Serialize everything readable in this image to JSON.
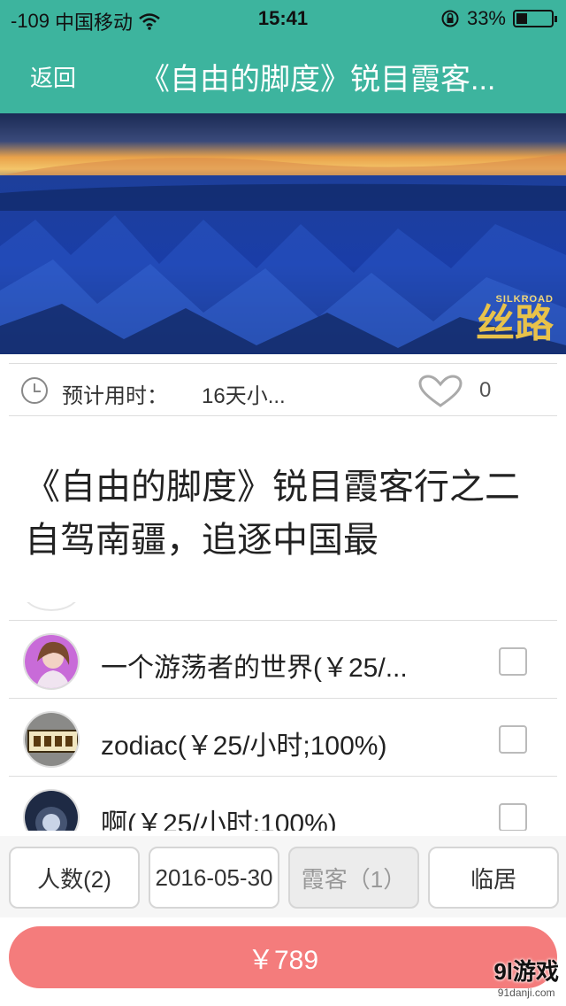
{
  "status_bar": {
    "signal": "-109",
    "carrier": "中国移动",
    "time": "15:41",
    "battery": "33%"
  },
  "nav": {
    "back_label": "返回",
    "title": "《自由的脚度》锐目霞客..."
  },
  "hero": {
    "brand_small": "SILKROAD",
    "brand_big": "丝路"
  },
  "trip": {
    "duration_label": "预计用时：",
    "duration_value": "16天小...",
    "like_count": "0"
  },
  "article": {
    "title": "《自由的脚度》锐目霞客行之二 自驾南疆，追逐中国最"
  },
  "guides": [
    {
      "name": "一个游荡者的世界(￥25/...",
      "checked": false
    },
    {
      "name": "zodiac(￥25/小时;100%)",
      "checked": false
    },
    {
      "name": "啊(￥25/小时;100%)",
      "checked": false
    }
  ],
  "options": {
    "people": "人数(2)",
    "date": "2016-05-30",
    "xiake": "霞客（1）",
    "linju": "临居"
  },
  "price": {
    "label": "￥789"
  },
  "watermark": {
    "main": "9l游戏",
    "sub": "91danji.com"
  },
  "colors": {
    "accent": "#3db49e",
    "price_button": "#f47c7c"
  }
}
